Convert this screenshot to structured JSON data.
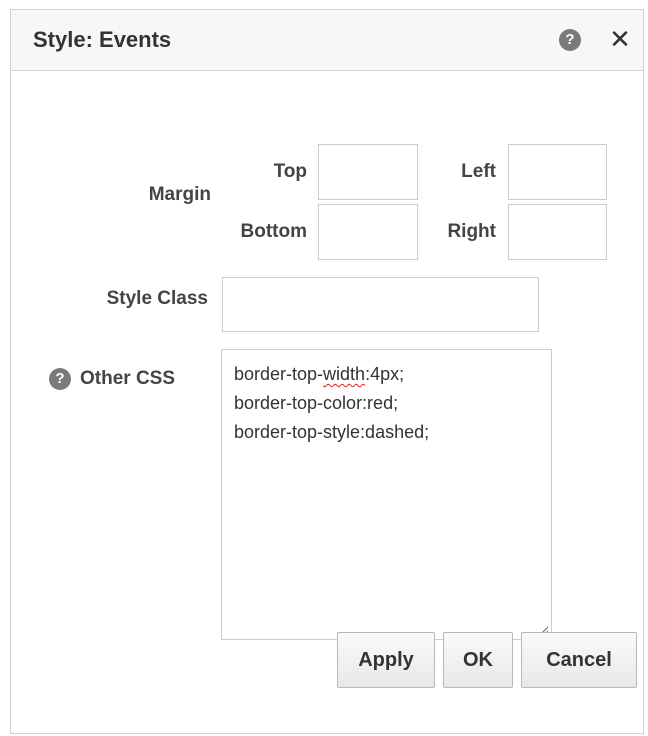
{
  "dialog": {
    "title": "Style: Events",
    "help_icon": "help-icon",
    "close_icon": "close-icon",
    "close_glyph": "✕"
  },
  "margin": {
    "label": "Margin",
    "top_label": "Top",
    "left_label": "Left",
    "bottom_label": "Bottom",
    "right_label": "Right",
    "top_value": "",
    "left_value": "",
    "bottom_value": "",
    "right_value": ""
  },
  "style_class": {
    "label": "Style Class",
    "value": ""
  },
  "other_css": {
    "label": "Other CSS",
    "line1_prefix": "border-top-",
    "line1_misspelled": "width",
    "line1_suffix": ":4px;",
    "line2": "border-top-color:red;",
    "line3": "border-top-style:dashed;"
  },
  "buttons": {
    "apply": "Apply",
    "ok": "OK",
    "cancel": "Cancel"
  }
}
